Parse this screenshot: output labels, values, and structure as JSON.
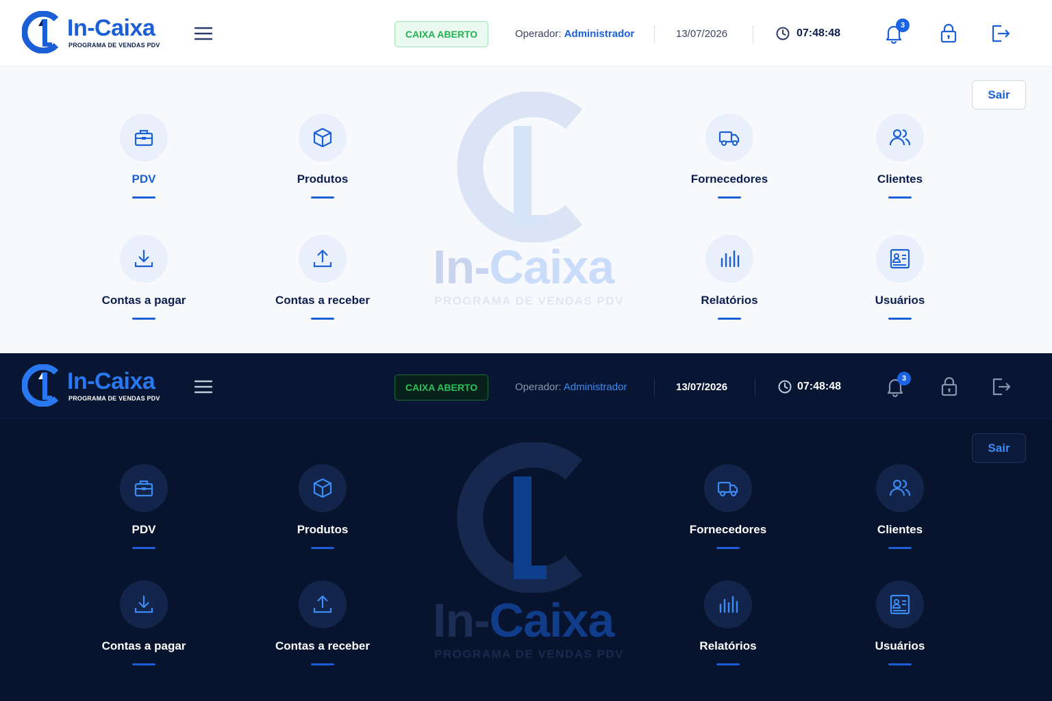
{
  "brand": {
    "name": "In-Caixa",
    "tagline": "PROGRAMA DE VENDAS PDV",
    "name_part1": "In-",
    "name_part2": "Caixa"
  },
  "colors": {
    "accent": "#1a5fd6",
    "status_green": "#20b24f",
    "dark_bg": "#08142e",
    "light_bg": "#f7f9fd"
  },
  "header": {
    "menu_icon": "hamburger-icon",
    "status": "CAIXA ABERTO",
    "operator_label": "Operador:",
    "operator_name": "Administrador",
    "date": "13/07/2026",
    "time": "07:48:48",
    "notifications_count": "3",
    "icons": [
      "bell-icon",
      "lock-icon",
      "logout-icon"
    ]
  },
  "exit_button": "Sair",
  "modules": [
    {
      "label": "PDV",
      "icon": "cash-register-icon"
    },
    {
      "label": "Produtos",
      "icon": "box-icon"
    },
    {
      "label": "Fornecedores",
      "icon": "truck-icon"
    },
    {
      "label": "Clientes",
      "icon": "users-icon"
    },
    {
      "label": "Contas a pagar",
      "icon": "download-icon"
    },
    {
      "label": "Contas a receber",
      "icon": "upload-icon"
    },
    {
      "label": "Relatórios",
      "icon": "bar-chart-icon"
    },
    {
      "label": "Usuários",
      "icon": "id-card-icon"
    }
  ],
  "themes": [
    "light",
    "dark"
  ]
}
